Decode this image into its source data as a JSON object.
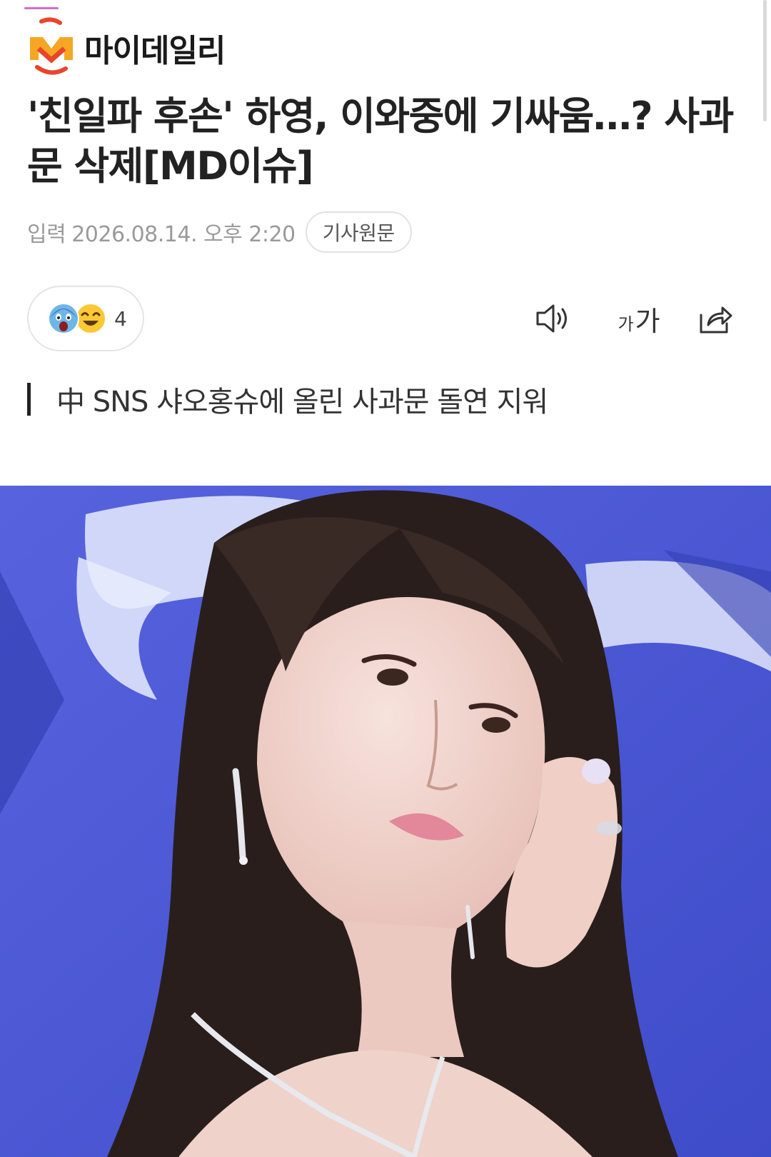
{
  "brand": {
    "name": "마이데일리",
    "logo_icon": "mydaily-logo-icon",
    "colors": {
      "logo_orange": "#f5a623",
      "logo_red": "#e8452c",
      "accent_pink": "#d86bc4"
    }
  },
  "article": {
    "headline": "'친일파 후손' 하영, 이와중에 기싸움…? 사과문 삭제[MD이슈]",
    "published_label": "입력",
    "published_date": "2026.08.14. 오후 2:20",
    "source_button": "기사원문",
    "subheading": "中 SNS 샤오홍슈에 올린 사과문 돌연 지워"
  },
  "reactions": {
    "icons": [
      "shocked-face-icon",
      "laughing-face-icon"
    ],
    "count": "4"
  },
  "toolbar": {
    "speaker_icon": "speaker-icon",
    "font_small": "가",
    "font_large": "가",
    "share_icon": "share-icon"
  },
  "photo": {
    "icon": "article-photo",
    "colors": {
      "background": "#4a5ad6",
      "hair": "#2a1e1c",
      "skin": "#f2d6cf"
    }
  }
}
